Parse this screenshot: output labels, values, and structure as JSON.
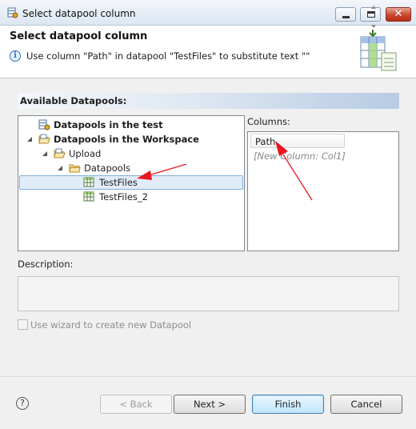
{
  "window": {
    "title": "Select datapool column"
  },
  "header": {
    "title": "Select datapool column",
    "message": "Use column \"Path\" in datapool \"TestFiles\" to substitute text \"\""
  },
  "datapools": {
    "section_label": "Available Datapools:",
    "tree": [
      {
        "label": "Datapools in the test",
        "bold": true,
        "expanded": null
      },
      {
        "label": "Datapools in the Workspace",
        "bold": true,
        "expanded": true
      },
      {
        "label": "Upload",
        "bold": false,
        "expanded": true
      },
      {
        "label": "Datapools",
        "bold": false,
        "expanded": true
      },
      {
        "label": "TestFiles",
        "bold": false,
        "selected": true
      },
      {
        "label": "TestFiles_2",
        "bold": false
      }
    ]
  },
  "columns": {
    "label": "Columns:",
    "items": [
      "Path"
    ],
    "new_column_placeholder": "[New Column: Col1]"
  },
  "description": {
    "label": "Description:",
    "value": ""
  },
  "wizard_checkbox": {
    "label": "Use wizard to create new Datapool",
    "checked": false,
    "enabled": false
  },
  "buttons": {
    "back": "< Back",
    "next": "Next >",
    "finish": "Finish",
    "cancel": "Cancel",
    "help": "?"
  },
  "icons": {
    "window": "datapool-gear-icon",
    "info": "info-icon",
    "banner": "datapool-table-icon",
    "folder": "folder-icon",
    "datapool": "table-grid-icon"
  },
  "colors": {
    "annotation_arrow": "#e8171d",
    "selection_fill": "#e1ecf9",
    "selection_border": "#84acdd",
    "default_button": "#3c7fb1"
  }
}
